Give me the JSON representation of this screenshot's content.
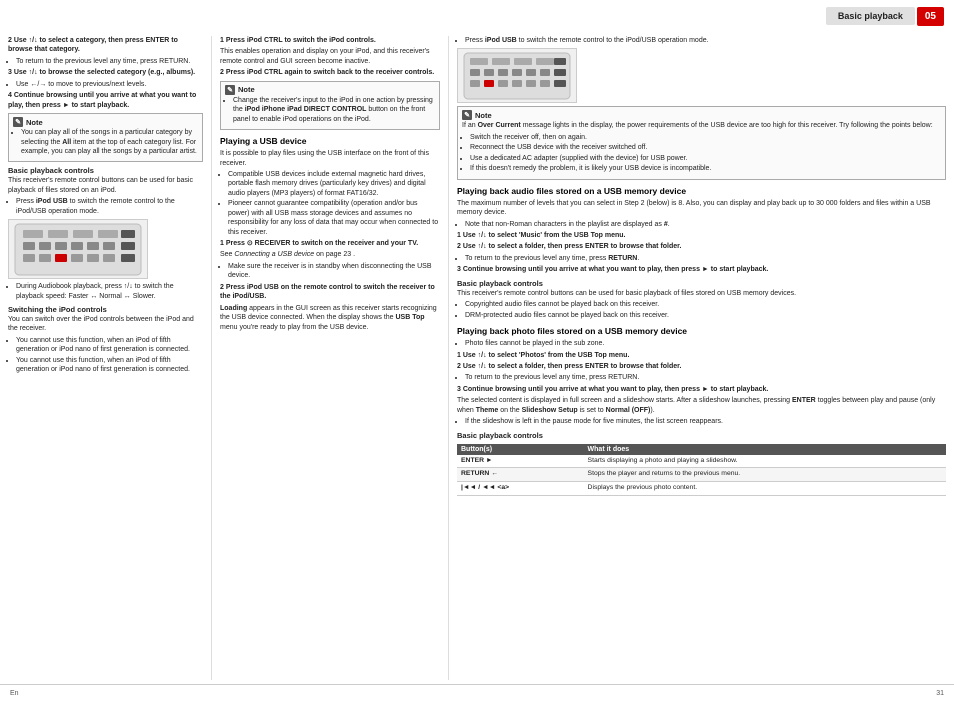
{
  "header": {
    "title": "Basic playback",
    "page_num": "05",
    "footer_lang": "En",
    "footer_page": "31"
  },
  "col_left": {
    "step2_title": "2  Use ↑/↓ to select a category, then press ENTER to browse that category.",
    "step2_bullet": "To return to the previous level any time, press RETURN.",
    "step3_title": "3  Use ↑/↓ to browse the selected category (e.g., albums).",
    "step3_bullet": "Use ←/→ to move to previous/next levels.",
    "step4_title": "4  Continue browsing until you arrive at what you want to play, then press ► to start playback.",
    "note_title": "Note",
    "note_bullets": [
      "You can play all of the songs in a particular category by selecting the All item at the top of each category list. For example, you can play all the songs by a particular artist."
    ],
    "basic_controls_title": "Basic playback controls",
    "basic_controls_text": "This receiver's remote control buttons can be used for basic playback of files stored on an iPod.",
    "basic_controls_bullet1": "Press iPod USB to switch the remote control to the iPod/USB operation mode.",
    "remote_img_alt": "Remote control image",
    "audiobook_bullet": "During Audiobook playback, press ↑/↓ to switch the playback speed: Faster ↔ Normal ↔ Slower.",
    "switching_title": "Switching the iPod controls",
    "switching_text": "You can switch over the iPod controls between the iPod and the receiver.",
    "switching_bullet1": "You cannot use this function, when an iPod of fifth generation or iPod nano of first generation is connected.",
    "switching_bullet2": "You cannot use this function, when an iPod of fifth generation or iPod nano of first generation is connected."
  },
  "col_mid": {
    "step1_title": "1  Press iPod CTRL to switch the iPod controls.",
    "step1_text": "This enables operation and display on your iPod, and this receiver's remote control and GUI screen become inactive.",
    "step2_title": "2  Press iPod CTRL again to switch back to the receiver controls.",
    "note_title": "Note",
    "note_bullets": [
      "Change the receiver's input to the iPod in one action by pressing the iPod iPhone iPad DIRECT CONTROL button on the front panel to enable iPod operations on the iPod."
    ],
    "playing_usb_title": "Playing a USB device",
    "playing_usb_text": "It is possible to play files using the USB interface on the front of this receiver.",
    "compatible_bullets": [
      "Compatible USB devices include external magnetic hard drives, portable flash memory drives (particularly key drives) and digital audio players (MP3 players) of format FAT16/32.",
      "Pioneer cannot guarantee compatibility (operation and/or bus power) with all USB mass storage devices and assumes no responsibility for any loss of data that may occur when connected to this receiver."
    ],
    "step1b_title": "1  Press ⊙ RECEIVER to switch on the receiver and your TV.",
    "step1b_sub": "See Connecting a USB device on page 23 .",
    "step1b_bullet": "Make sure the receiver is in standby when disconnecting the USB device.",
    "step2b_title": "2  Press iPod USB on the remote control to switch the receiver to the iPod/USB.",
    "step2b_text": "Loading appears in the GUI screen as this receiver starts recognizing the USB device connected. When the display shows the USB Top menu you're ready to play from the USB device."
  },
  "col_right": {
    "over_current_note_title": "Note",
    "over_current_text": "If an Over Current message lights in the display, the power requirements of the USB device are too high for this receiver. Try following the points below:",
    "over_current_bullets": [
      "Switch the receiver off, then on again.",
      "Reconnect the USB device with the receiver switched off.",
      "Use a dedicated AC adapter (supplied with the device) for USB power.",
      "If this doesn't remedy the problem, it is likely your USB device is incompatible."
    ],
    "playing_audio_usb_title": "Playing back audio files stored on a USB memory device",
    "playing_audio_usb_text": "The maximum number of levels that you can select in Step 2 (below) is 8. Also, you can display and play back up to 30 000 folders and files within a USB memory device.",
    "playing_audio_bullets": [
      "Note that non-Roman characters in the playlist are displayed as #."
    ],
    "press_ipod_usb_bullet": "Press iPod USB to switch the remote control to the iPod/USB operation mode.",
    "remote_img_alt": "Remote control image right",
    "step1c_title": "1  Use ↑/↓ to select 'Music' from the USB Top menu.",
    "step2c_title": "2  Use ↑/↓ to select a folder, then press ENTER to browse that folder.",
    "step2c_bullet": "To return to the previous level any time, press RETURN.",
    "step3c_title": "3  Continue browsing until you arrive at what you want to play, then press ► to start playback.",
    "basic_controls2_title": "Basic playback controls",
    "basic_controls2_text": "This receiver's remote control buttons can be used for basic playback of files stored on USB memory devices.",
    "basic_controls2_bullets": [
      "Copyrighted audio files cannot be played back on this receiver.",
      "DRM-protected audio files cannot be played back on this receiver."
    ],
    "playing_photo_title": "Playing back photo files stored on a USB memory device",
    "playing_photo_bullet": "Photo files cannot be played in the sub zone.",
    "step1d_title": "1  Use ↑/↓ to select 'Photos' from the USB Top menu.",
    "step2d_title": "2  Use ↑/↓ to select a folder, then press ENTER to browse that folder.",
    "step2d_bullet": "To return to the previous level any time, press RETURN.",
    "step3d_title": "3  Continue browsing until you arrive at what you want to play, then press ► to start playback.",
    "step3d_text": "The selected content is displayed in full screen and a slideshow starts. After a slideshow launches, pressing ENTER toggles between play and pause (only when Theme on the Slideshow Setup is set to Normal (OFF)).",
    "step3d_bullet": "If the slideshow is left in the pause mode for five minutes, the list screen reappears.",
    "basic_controls3_title": "Basic playback controls",
    "table_headers": [
      "Button(s)",
      "What it does"
    ],
    "table_rows": [
      {
        "button": "ENTER ►",
        "action": "Starts displaying a photo and playing a slideshow."
      },
      {
        "button": "RETURN ←",
        "action": "Stops the player and returns to the previous menu."
      },
      {
        "button": "|◄◄ / ◄◄ <a>",
        "action": "Displays the previous photo content."
      }
    ]
  }
}
